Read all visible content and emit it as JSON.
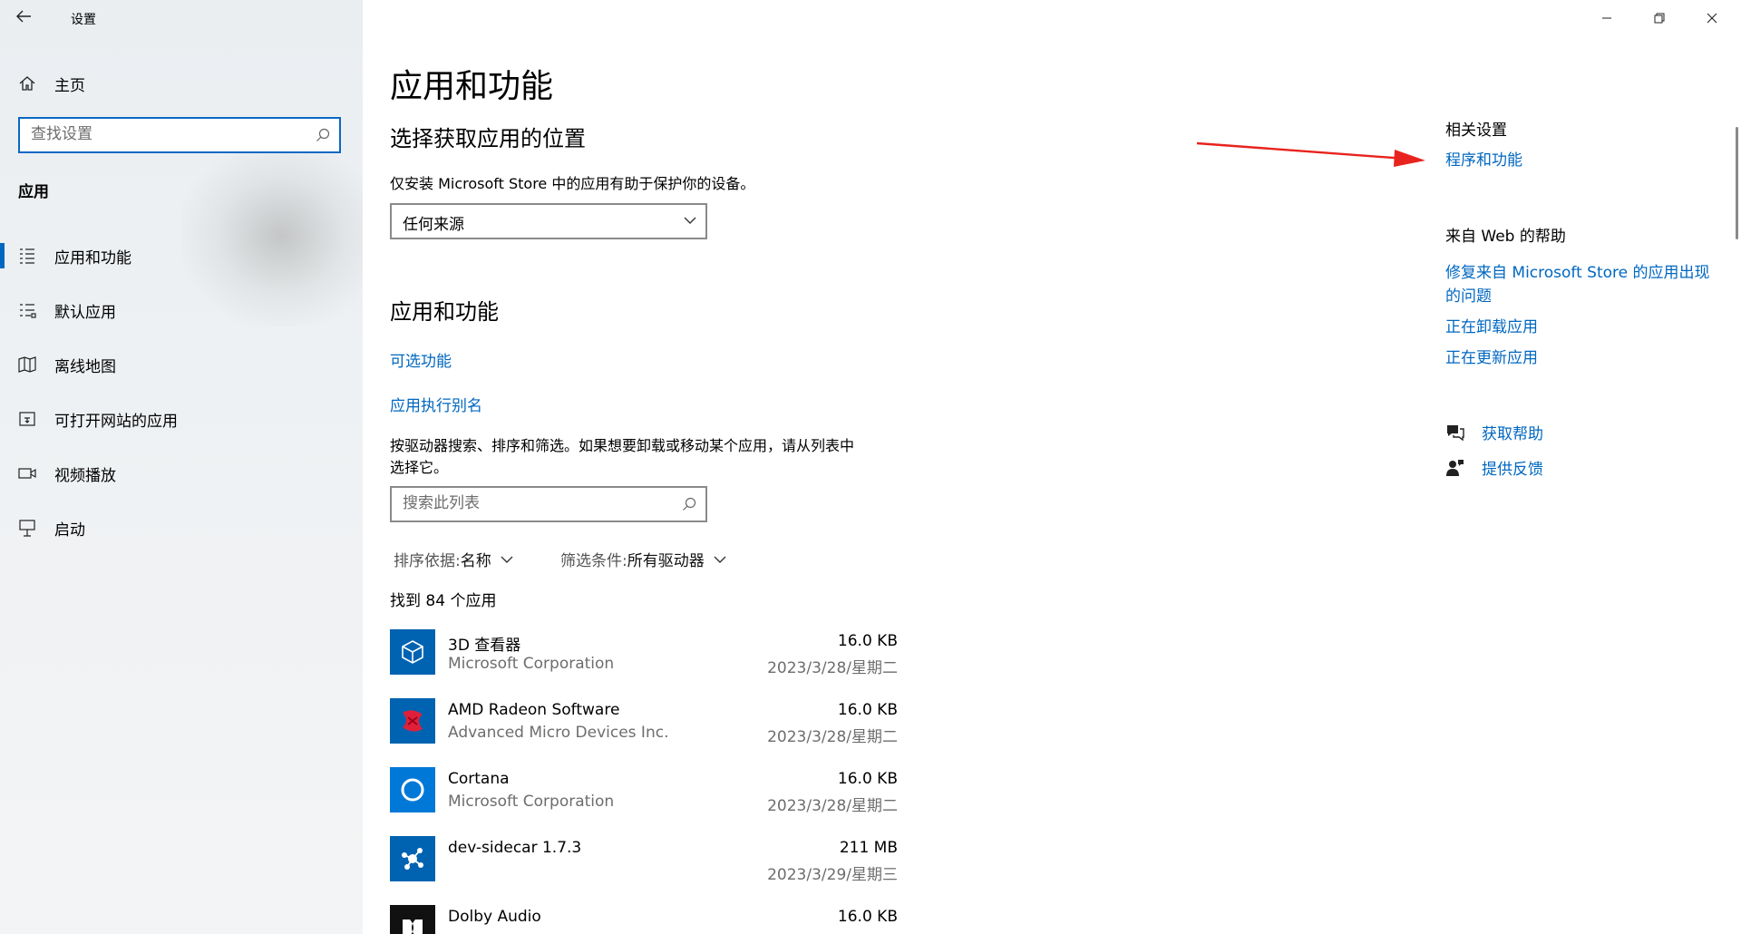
{
  "window": {
    "title": "设置"
  },
  "sidebar": {
    "home_label": "主页",
    "search_placeholder": "查找设置",
    "section_label": "应用",
    "items": [
      {
        "label": "应用和功能",
        "icon": "apps-list-icon",
        "active": true
      },
      {
        "label": "默认应用",
        "icon": "default-apps-icon"
      },
      {
        "label": "离线地图",
        "icon": "offline-map-icon"
      },
      {
        "label": "可打开网站的应用",
        "icon": "website-apps-icon"
      },
      {
        "label": "视频播放",
        "icon": "video-icon"
      },
      {
        "label": "启动",
        "icon": "startup-icon"
      }
    ]
  },
  "main": {
    "title": "应用和功能",
    "source_heading": "选择获取应用的位置",
    "source_desc": "仅安装 Microsoft Store 中的应用有助于保护你的设备。",
    "source_value": "任何来源",
    "apps_heading": "应用和功能",
    "optional_features_link": "可选功能",
    "alias_link": "应用执行别名",
    "list_desc_line1": "按驱动器搜索、排序和筛选。如果想要卸载或移动某个应用，请从列表中",
    "list_desc_line2": "选择它。",
    "list_search_placeholder": "搜索此列表",
    "sort_key": "排序依据:",
    "sort_value": "名称",
    "filter_key": "筛选条件:",
    "filter_value": "所有驱动器",
    "count_text": "找到 84 个应用",
    "apps": [
      {
        "name": "3D 查看器",
        "publisher": "Microsoft Corporation",
        "size": "16.0 KB",
        "date": "2023/3/28/星期二",
        "icon": "3d-viewer-icon",
        "color": "#0063b1"
      },
      {
        "name": "AMD Radeon Software",
        "publisher": "Advanced Micro Devices Inc.",
        "size": "16.0 KB",
        "date": "2023/3/28/星期二",
        "icon": "amd-radeon-icon",
        "color": "#0063b1"
      },
      {
        "name": "Cortana",
        "publisher": "Microsoft Corporation",
        "size": "16.0 KB",
        "date": "2023/3/28/星期二",
        "icon": "cortana-icon",
        "color": "#0078d7"
      },
      {
        "name": "dev-sidecar 1.7.3",
        "publisher": "",
        "size": "211 MB",
        "date": "2023/3/29/星期三",
        "icon": "dev-sidecar-icon",
        "color": "#0063b1"
      },
      {
        "name": "Dolby Audio",
        "publisher": "",
        "size": "16.0 KB",
        "date": "",
        "icon": "dolby-icon",
        "color": "#111111"
      }
    ]
  },
  "related": {
    "heading": "相关设置",
    "programs_link": "程序和功能",
    "web_help_heading": "来自 Web 的帮助",
    "web_links": [
      "修复来自 Microsoft Store 的应用出现",
      "的问题",
      "正在卸载应用",
      "正在更新应用"
    ],
    "get_help": "获取帮助",
    "feedback": "提供反馈"
  },
  "colors": {
    "accent": "#0067c0",
    "annotation_arrow": "#e8231d"
  }
}
